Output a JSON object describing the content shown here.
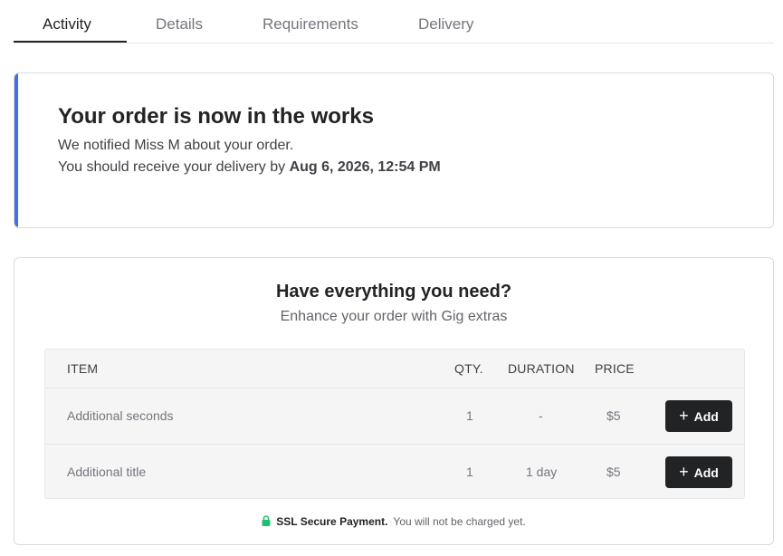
{
  "tabs": [
    {
      "label": "Activity",
      "active": true
    },
    {
      "label": "Details",
      "active": false
    },
    {
      "label": "Requirements",
      "active": false
    },
    {
      "label": "Delivery",
      "active": false
    }
  ],
  "status": {
    "title": "Your order is now in the works",
    "line1": "We notified Miss M about your order.",
    "line2_prefix": "You should receive your delivery by ",
    "line2_date": "Aug 6, 2026, 12:54 PM",
    "accent_color": "#446ee7"
  },
  "extras": {
    "title": "Have everything you need?",
    "subtitle": "Enhance your order with Gig extras",
    "columns": {
      "item": "ITEM",
      "qty": "QTY.",
      "duration": "DURATION",
      "price": "PRICE"
    },
    "rows": [
      {
        "item": "Additional seconds",
        "qty": "1",
        "duration": "-",
        "price": "$5",
        "action": "Add"
      },
      {
        "item": "Additional title",
        "qty": "1",
        "duration": "1 day",
        "price": "$5",
        "action": "Add"
      }
    ]
  },
  "ssl": {
    "label": "SSL Secure Payment.",
    "note": "You will not be charged yet.",
    "icon": "lock-icon",
    "icon_color": "#1dbf73"
  }
}
